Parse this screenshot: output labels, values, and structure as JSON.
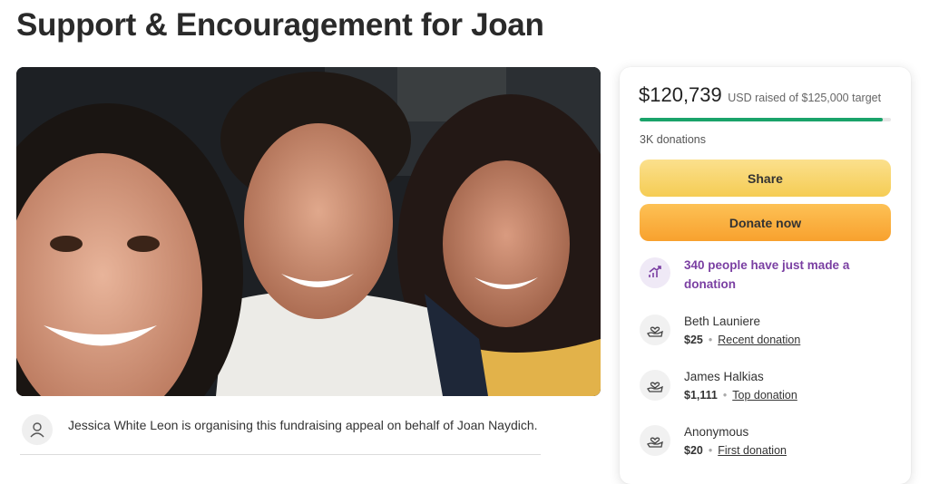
{
  "page": {
    "title": "Support & Encouragement for Joan"
  },
  "organiser": {
    "text": "Jessica White Leon is organising this fundraising appeal on behalf of Joan Naydich."
  },
  "sidebar": {
    "raised_amount": "$120,739",
    "raised_suffix": "USD raised of $125,000 target",
    "progress_fraction": 0.966,
    "donations_count": "3K donations",
    "share_label": "Share",
    "donate_label": "Donate now",
    "activity_text": "340 people have just made a donation",
    "donors": [
      {
        "name": "Beth Launiere",
        "amount": "$25",
        "tag": "Recent donation"
      },
      {
        "name": "James Halkias",
        "amount": "$1,111",
        "tag": "Top donation"
      },
      {
        "name": "Anonymous",
        "amount": "$20",
        "tag": "First donation"
      }
    ]
  },
  "colors": {
    "progress": "#1aa36a",
    "share_button": "#f5cc54",
    "donate_button": "#f8a12e",
    "activity_text": "#7a3fa2"
  },
  "icons": {
    "organiser_avatar": "user-icon",
    "activity": "trending-up-icon",
    "donor": "heart-hand-icon"
  }
}
